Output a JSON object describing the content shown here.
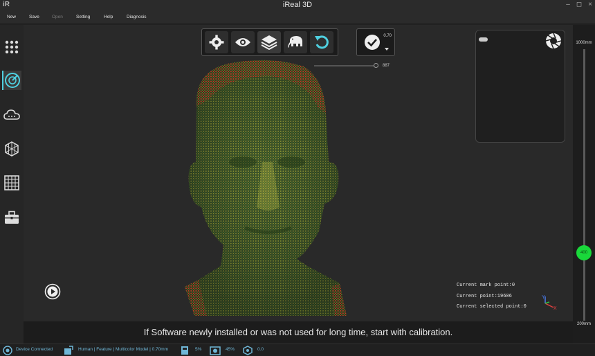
{
  "app": {
    "title": "iReal 3D",
    "logo": "iR"
  },
  "window_controls": [
    "–",
    "◻",
    "×"
  ],
  "menu": [
    {
      "label": "New",
      "enabled": true
    },
    {
      "label": "Save",
      "enabled": true
    },
    {
      "label": "Open",
      "enabled": false
    },
    {
      "label": "Setting",
      "enabled": true
    },
    {
      "label": "Help",
      "enabled": true
    },
    {
      "label": "Diagnosis",
      "enabled": true
    }
  ],
  "sidebar": {
    "items": [
      {
        "icon": "grid-dots-icon",
        "active": false
      },
      {
        "icon": "scan-target-icon",
        "active": true
      },
      {
        "icon": "cloud-icon",
        "active": false
      },
      {
        "icon": "mesh-icon",
        "active": false
      },
      {
        "icon": "grid-table-icon",
        "active": false
      },
      {
        "icon": "toolbox-icon",
        "active": false
      }
    ]
  },
  "toolbar": {
    "buttons": [
      "settings-gear-icon",
      "eye-icon",
      "layers-icon",
      "elephant-icon",
      "undo-icon"
    ]
  },
  "threshold": {
    "value": "0.70"
  },
  "point_slider": {
    "value": "887"
  },
  "stats": {
    "mark": "Current mark point:0",
    "point": "Current point:19606",
    "selected": "Current selected point:0"
  },
  "axes": {
    "y": "Y",
    "x": "X"
  },
  "message": "If Software newly installed or was not used for long time, start with calibration.",
  "distance": {
    "max": "1000mm",
    "min": "200mm",
    "current": "400",
    "current_value_mm": 400
  },
  "status": {
    "device": "Device Connected",
    "mode": "Human | Feature | Multicolor Model | 0.70mm",
    "storage": "5%",
    "camera": "45%",
    "other": "0.0"
  },
  "colors": {
    "accent": "#4fd0e0",
    "distance_knob": "#19d83a",
    "status_text": "#6fb7d8"
  }
}
